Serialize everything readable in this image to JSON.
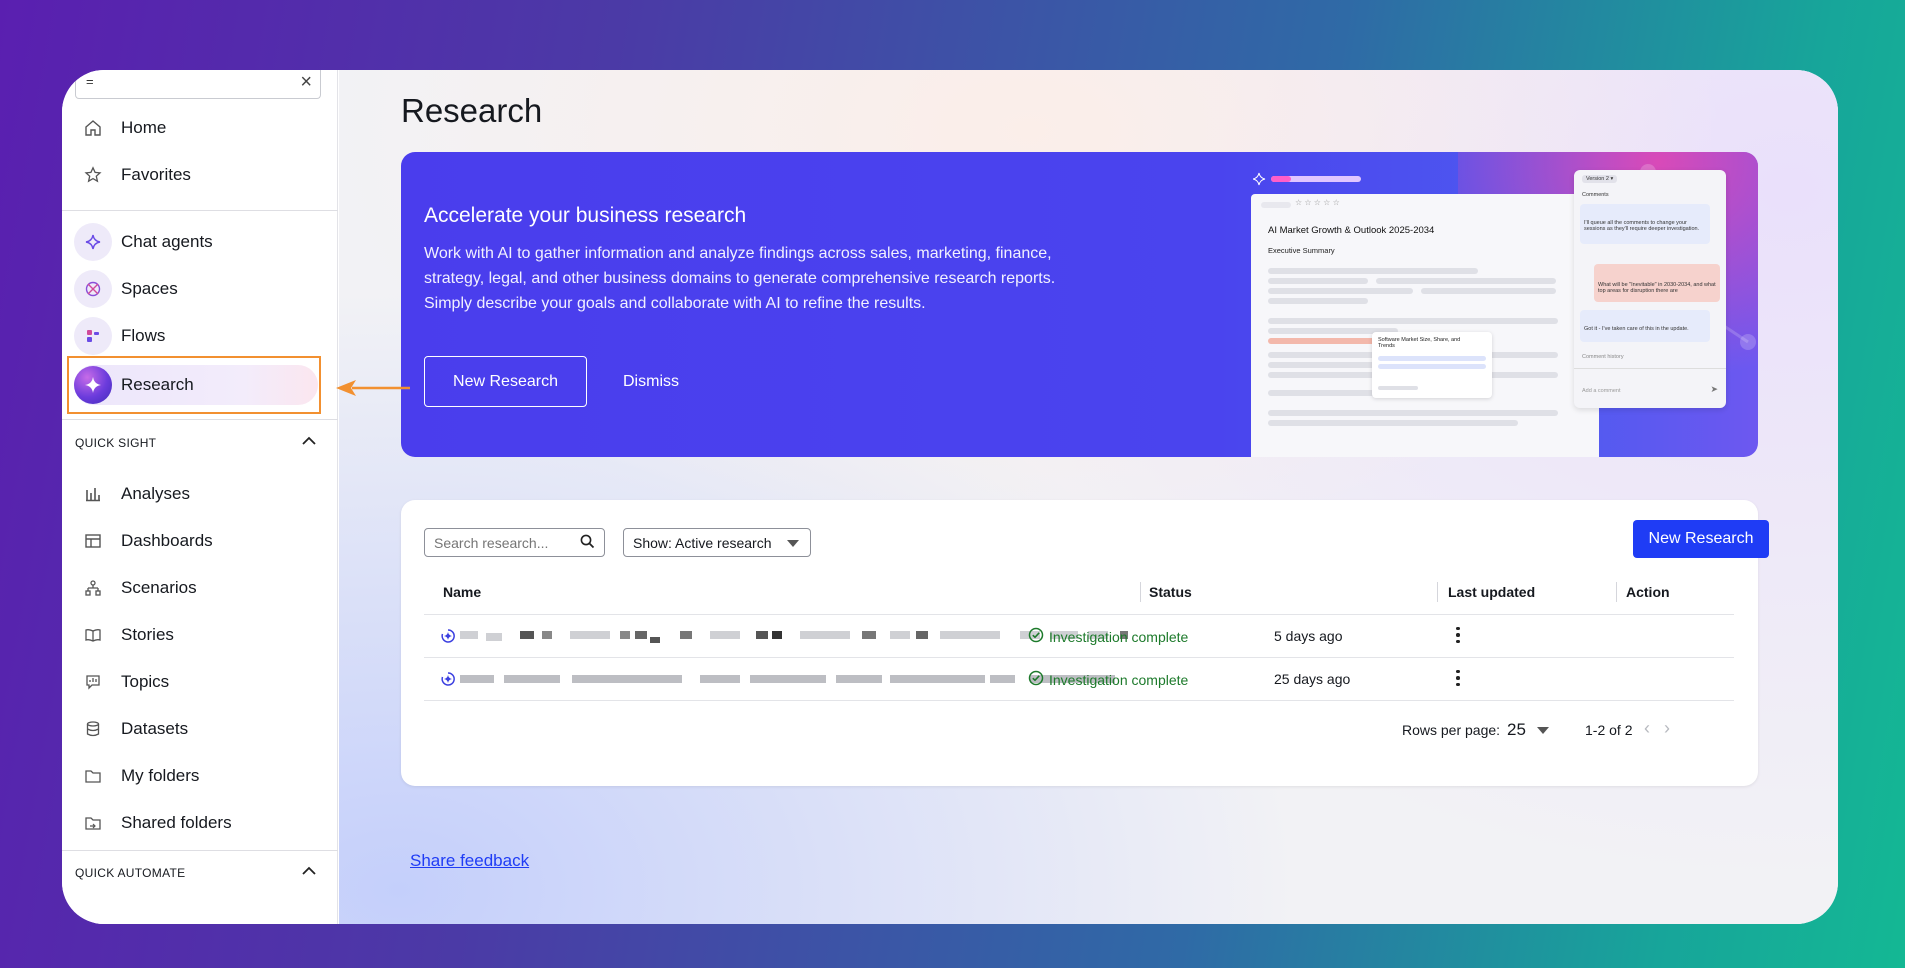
{
  "sidebar": {
    "search_value": "=",
    "items_top": [
      {
        "label": "Home"
      },
      {
        "label": "Favorites"
      }
    ],
    "items_ai": [
      {
        "label": "Chat agents"
      },
      {
        "label": "Spaces"
      },
      {
        "label": "Flows"
      },
      {
        "label": "Research"
      }
    ],
    "section_quick_sight": "QUICK SIGHT",
    "items_quick_sight": [
      {
        "label": "Analyses"
      },
      {
        "label": "Dashboards"
      },
      {
        "label": "Scenarios"
      },
      {
        "label": "Stories"
      },
      {
        "label": "Topics"
      },
      {
        "label": "Datasets"
      },
      {
        "label": "My folders"
      },
      {
        "label": "Shared folders"
      }
    ],
    "section_quick_automate": "QUICK AUTOMATE"
  },
  "main": {
    "page_title": "Research",
    "banner": {
      "heading": "Accelerate your business research",
      "body": "Work with AI to gather information and analyze findings across sales, marketing, finance, strategy, legal, and other business domains to generate comprehensive research reports. Simply describe your goals and collaborate with AI to refine the results.",
      "primary_button": "New Research",
      "secondary_button": "Dismiss",
      "preview": {
        "doc_title": "AI Market Growth & Outlook 2025-2034",
        "doc_subtitle": "Executive Summary",
        "popup_title": "Software Market Size, Share, and Trends",
        "comments_version": "Version 2 ▾",
        "comments_label": "Comments",
        "comment_1": "I'll queue all the comments to change your sessions as they'll require deeper investigation.",
        "comment_2": "What will be \"Inevitable\" in 2030-2034, and what top areas for disruption there are",
        "comment_3": "Got it - I've taken care of this in the update.",
        "comment_history": "Comment history",
        "add_comment": "Add a comment"
      }
    },
    "table": {
      "search_placeholder": "Search research...",
      "filter_value": "Show: Active research",
      "new_button": "New Research",
      "columns": [
        "Name",
        "Status",
        "Last updated",
        "Action"
      ],
      "rows": [
        {
          "status": "Investigation complete",
          "updated": "5 days ago"
        },
        {
          "status": "Investigation complete",
          "updated": "25 days ago"
        }
      ],
      "rows_per_page_label": "Rows per page:",
      "rows_per_page_value": "25",
      "range": "1-2 of 2"
    },
    "feedback_link": "Share feedback"
  },
  "colors": {
    "accent": "#1f3cf5",
    "banner": "#4a3ded",
    "highlight_box": "#f29030",
    "status_success": "#1d7a2b"
  }
}
